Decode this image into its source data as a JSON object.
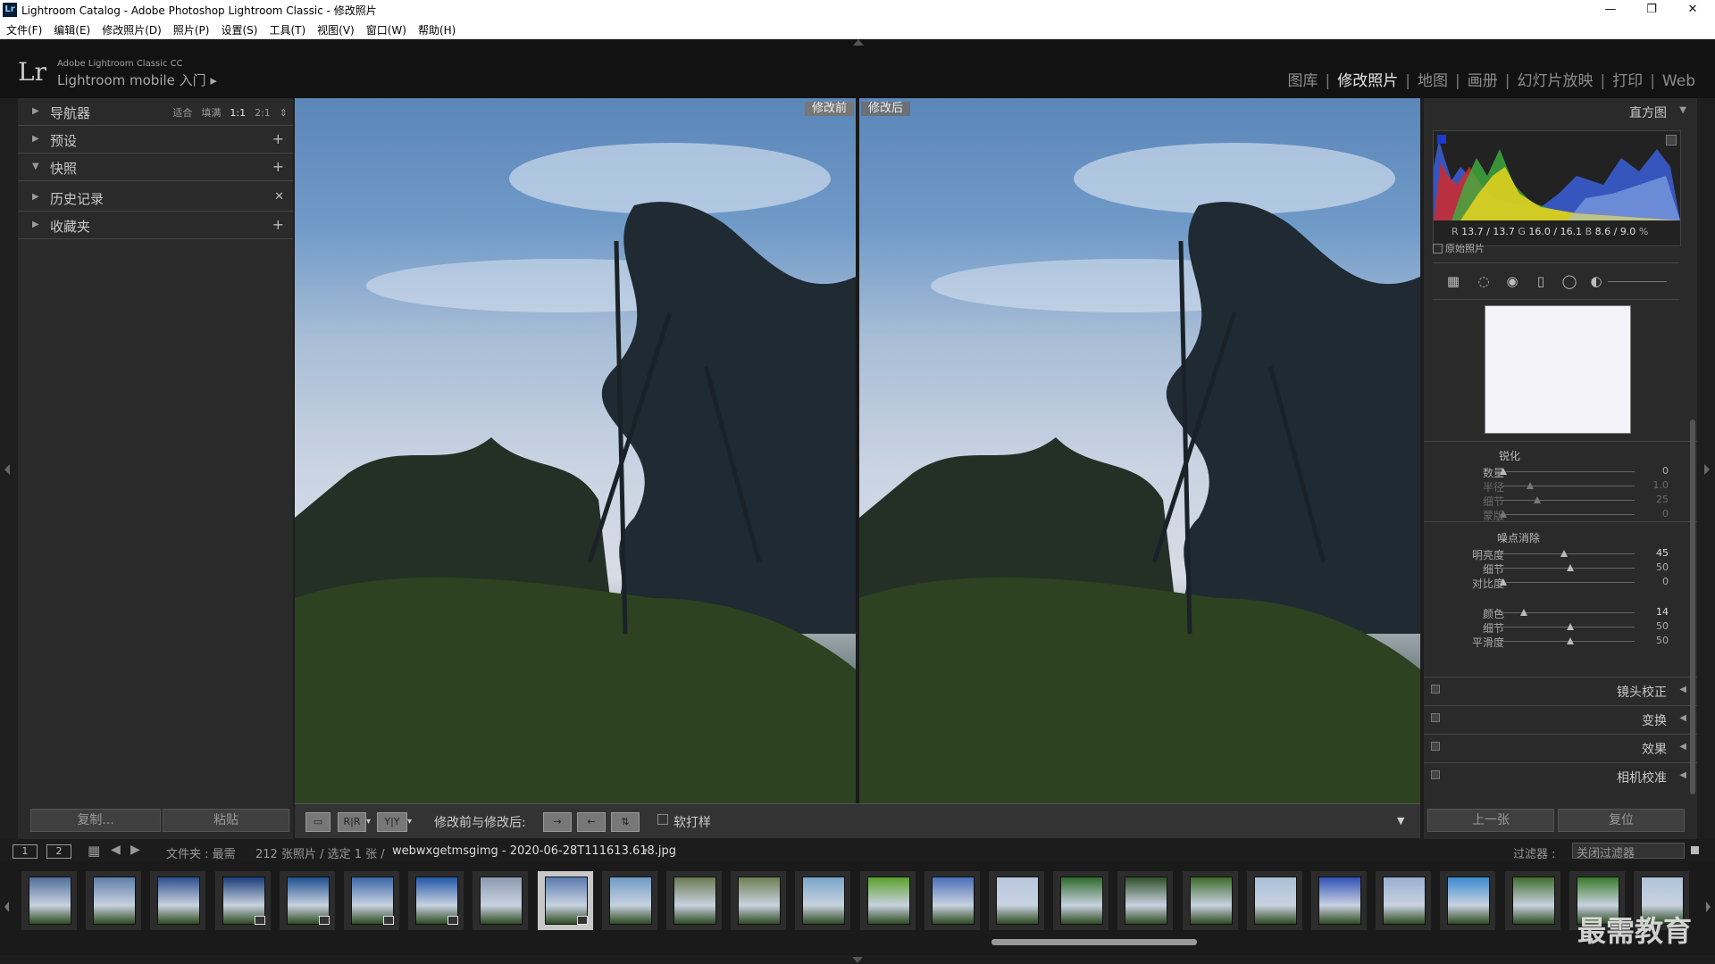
{
  "window": {
    "title": "Lightroom Catalog - Adobe Photoshop Lightroom Classic - 修改照片",
    "app_icon": "Lr"
  },
  "menu": [
    "文件(F)",
    "编辑(E)",
    "修改照片(D)",
    "照片(P)",
    "设置(S)",
    "工具(T)",
    "视图(V)",
    "窗口(W)",
    "帮助(H)"
  ],
  "identity": {
    "logo": "Lr",
    "line1": "Adobe Lightroom Classic CC",
    "line2": "Lightroom mobile 入门 ▸"
  },
  "modules": [
    "图库",
    "修改照片",
    "地图",
    "画册",
    "幻灯片放映",
    "打印",
    "Web"
  ],
  "active_module": "修改照片",
  "left_panel": {
    "navigator": {
      "label": "导航器",
      "options": [
        "适合",
        "填满",
        "1:1",
        "2:1"
      ],
      "selected": "1:1"
    },
    "presets": {
      "label": "预设"
    },
    "snapshots": {
      "label": "快照"
    },
    "history": {
      "label": "历史记录"
    },
    "collections": {
      "label": "收藏夹"
    },
    "copy_button": "复制...",
    "paste_button": "粘贴"
  },
  "view": {
    "before_tag": "修改前",
    "after_tag": "修改后"
  },
  "toolbar": {
    "compare_label": "修改前与修改后:",
    "softproof": "软打样",
    "rr": "R|R",
    "yy": "Y|Y"
  },
  "right_panel": {
    "histogram_label": "直方图",
    "rgb": {
      "r_label": "R",
      "r": "13.7 / 13.7",
      "g_label": "G",
      "g": "16.0 / 16.1",
      "b_label": "B",
      "b": "8.6 /",
      "b2": "9.0",
      "pct": "%"
    },
    "original_photo": "原始照片",
    "sharpening": {
      "title": "锐化",
      "rows": [
        {
          "label": "数量",
          "value": "0",
          "pos": 0.02
        },
        {
          "label": "半径",
          "value": "1.0",
          "pos": 0.22
        },
        {
          "label": "细节",
          "value": "25",
          "pos": 0.27
        },
        {
          "label": "蒙版",
          "value": "0",
          "pos": 0.02
        }
      ]
    },
    "noise": {
      "title": "噪点消除",
      "rows": [
        {
          "label": "明亮度",
          "value": "45",
          "pos": 0.47
        },
        {
          "label": "细节",
          "value": "50",
          "pos": 0.52
        },
        {
          "label": "对比度",
          "value": "0",
          "pos": 0.02
        },
        {
          "label": "颜色",
          "value": "14",
          "pos": 0.17
        },
        {
          "label": "细节",
          "value": "50",
          "pos": 0.52
        },
        {
          "label": "平滑度",
          "value": "50",
          "pos": 0.52
        }
      ]
    },
    "sections": [
      "镜头校正",
      "变换",
      "效果",
      "相机校准"
    ],
    "prev_button": "上一张",
    "reset_button": "复位"
  },
  "filmstrip_header": {
    "mon1": "1",
    "mon2": "2",
    "folder": "文件夹 : 最需",
    "count": "212 张照片 / 选定 1 张 /",
    "filename": "webwxgetmsgimg - 2020-06-28T111613.618.jpg",
    "filter_label": "过滤器 :",
    "filter_value": "关闭过滤器"
  },
  "filmstrip": {
    "selected_index": 8,
    "thumbs": [
      "#4e6e9a",
      "#5d7ea8",
      "#2c4f8c",
      "#1b3d7a",
      "#1e4f8f",
      "#3a66a8",
      "#2257a8",
      "#8a9ab0",
      "#5a7cb0",
      "#6f9bc4",
      "#6a7a50",
      "#6d8050",
      "#7aa6c9",
      "#5aa02a",
      "#4a6fb8",
      "#b8c8de",
      "#2e6a2a",
      "#2f4f2a",
      "#3c6a2a",
      "#a8c0d8",
      "#3050b8",
      "#98b0d0",
      "#3a8ad0",
      "#3e6e2e",
      "#3a7a2a",
      "#b0c4d8"
    ],
    "badges": [
      3,
      4,
      5,
      6,
      8
    ]
  },
  "watermark": "最需教育"
}
